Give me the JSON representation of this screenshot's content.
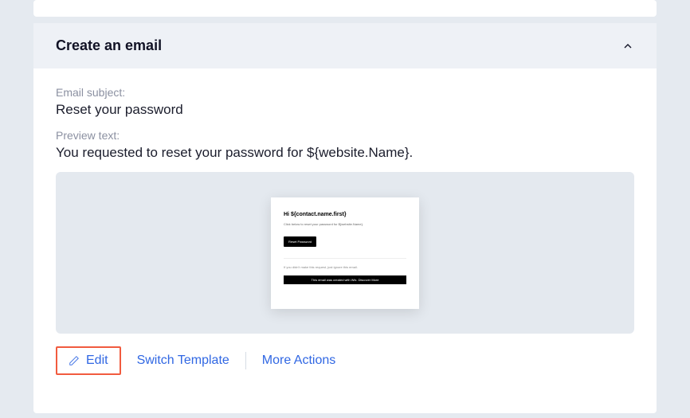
{
  "panel": {
    "title": "Create an email",
    "subject_label": "Email subject:",
    "subject_value": "Reset your password",
    "preview_label": "Preview text:",
    "preview_value": "You requested to reset your password for ${website.Name}."
  },
  "email_preview": {
    "greeting": "Hi ${contact.name.first}",
    "line": "Click below to reset your password for ${website.Name}.",
    "button": "Reset Password",
    "note": "If you didn't make this request, just ignore this email.",
    "footer": "This email was created with Wix.  Discover More"
  },
  "actions": {
    "edit": "Edit",
    "switch": "Switch Template",
    "more": "More Actions"
  }
}
